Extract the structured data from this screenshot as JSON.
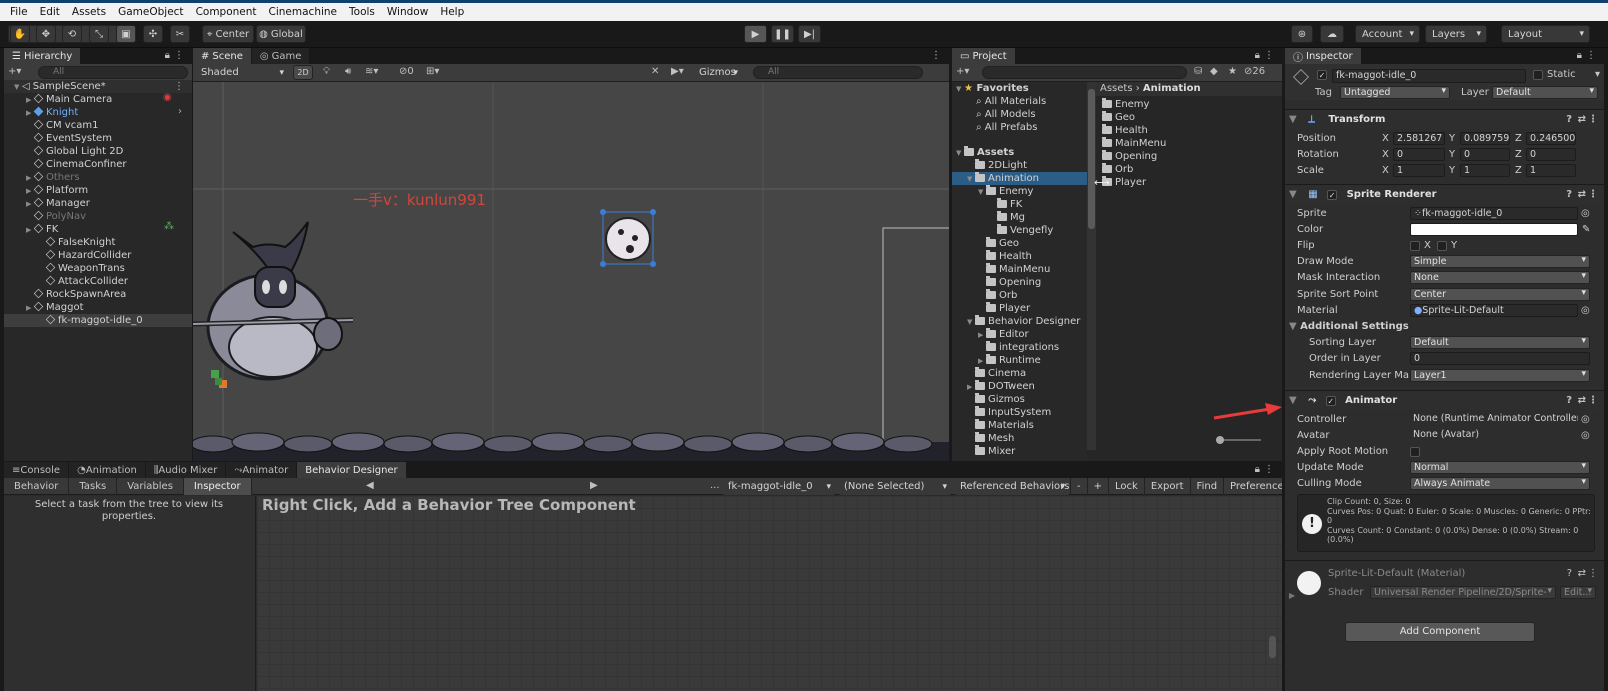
{
  "menu": [
    "File",
    "Edit",
    "Assets",
    "GameObject",
    "Component",
    "Cinemachine",
    "Tools",
    "Window",
    "Help"
  ],
  "toolbar": {
    "pivot": "Center",
    "space": "Global",
    "account": "Account",
    "layers": "Layers",
    "layout": "Layout"
  },
  "hierarchy": {
    "tab": "Hierarchy",
    "search_placeholder": "All",
    "scene": "SampleScene*",
    "items": [
      {
        "label": "Main Camera",
        "depth": 1,
        "arrow": true,
        "style": "normal"
      },
      {
        "label": "Knight",
        "depth": 1,
        "arrow": true,
        "style": "prefab"
      },
      {
        "label": "CM vcam1",
        "depth": 1,
        "arrow": false,
        "style": "normal"
      },
      {
        "label": "EventSystem",
        "depth": 1,
        "arrow": false,
        "style": "normal"
      },
      {
        "label": "Global Light 2D",
        "depth": 1,
        "arrow": false,
        "style": "normal"
      },
      {
        "label": "CinemaConfiner",
        "depth": 1,
        "arrow": false,
        "style": "normal"
      },
      {
        "label": "Others",
        "depth": 1,
        "arrow": true,
        "style": "dim"
      },
      {
        "label": "Platform",
        "depth": 1,
        "arrow": true,
        "style": "normal"
      },
      {
        "label": "Manager",
        "depth": 1,
        "arrow": true,
        "style": "normal"
      },
      {
        "label": "PolyNav",
        "depth": 1,
        "arrow": false,
        "style": "dim"
      },
      {
        "label": "FK",
        "depth": 1,
        "arrow": true,
        "style": "normal"
      },
      {
        "label": "FalseKnight",
        "depth": 2,
        "arrow": false,
        "style": "normal"
      },
      {
        "label": "HazardCollider",
        "depth": 2,
        "arrow": false,
        "style": "normal"
      },
      {
        "label": "WeaponTrans",
        "depth": 2,
        "arrow": false,
        "style": "normal"
      },
      {
        "label": "AttackCollider",
        "depth": 2,
        "arrow": false,
        "style": "normal"
      },
      {
        "label": "RockSpawnArea",
        "depth": 1,
        "arrow": false,
        "style": "normal"
      },
      {
        "label": "Maggot",
        "depth": 1,
        "arrow": true,
        "style": "normal"
      },
      {
        "label": "fk-maggot-idle_0",
        "depth": 2,
        "arrow": false,
        "style": "selected"
      }
    ]
  },
  "scene": {
    "tabs": [
      "Scene",
      "Game"
    ],
    "shading": "Shaded",
    "mode2d": "2D",
    "gizmos": "Gizmos",
    "gizmo_count": "0",
    "search_placeholder": "All",
    "watermark": "一手v：kunlun991"
  },
  "project": {
    "tab": "Project",
    "count": "26",
    "favorites_label": "Favorites",
    "favorites": [
      "All Materials",
      "All Models",
      "All Prefabs"
    ],
    "assets_label": "Assets",
    "tree": [
      {
        "label": "2DLight",
        "depth": 1,
        "sel": false
      },
      {
        "label": "Animation",
        "depth": 1,
        "sel": true
      },
      {
        "label": "Enemy",
        "depth": 2,
        "sel": false
      },
      {
        "label": "FK",
        "depth": 3,
        "sel": false
      },
      {
        "label": "Mg",
        "depth": 3,
        "sel": false
      },
      {
        "label": "Vengefly",
        "depth": 3,
        "sel": false
      },
      {
        "label": "Geo",
        "depth": 2,
        "sel": false
      },
      {
        "label": "Health",
        "depth": 2,
        "sel": false
      },
      {
        "label": "MainMenu",
        "depth": 2,
        "sel": false
      },
      {
        "label": "Opening",
        "depth": 2,
        "sel": false
      },
      {
        "label": "Orb",
        "depth": 2,
        "sel": false
      },
      {
        "label": "Player",
        "depth": 2,
        "sel": false
      },
      {
        "label": "Behavior Designer",
        "depth": 1,
        "sel": false
      },
      {
        "label": "Editor",
        "depth": 2,
        "sel": false
      },
      {
        "label": "integrations",
        "depth": 2,
        "sel": false
      },
      {
        "label": "Runtime",
        "depth": 2,
        "sel": false
      },
      {
        "label": "Cinema",
        "depth": 1,
        "sel": false
      },
      {
        "label": "DOTween",
        "depth": 1,
        "sel": false
      },
      {
        "label": "Gizmos",
        "depth": 1,
        "sel": false
      },
      {
        "label": "InputSystem",
        "depth": 1,
        "sel": false
      },
      {
        "label": "Materials",
        "depth": 1,
        "sel": false
      },
      {
        "label": "Mesh",
        "depth": 1,
        "sel": false
      },
      {
        "label": "Mixer",
        "depth": 1,
        "sel": false
      }
    ],
    "breadcrumb": [
      "Assets",
      "Animation"
    ],
    "contents": [
      "Enemy",
      "Geo",
      "Health",
      "MainMenu",
      "Opening",
      "Orb",
      "Player"
    ]
  },
  "bottom": {
    "tabs": [
      "Console",
      "Animation",
      "Audio Mixer",
      "Animator",
      "Behavior Designer"
    ],
    "subtabs": [
      "Behavior",
      "Tasks",
      "Variables",
      "Inspector"
    ],
    "hint": "Select a task from the tree to view its properties.",
    "object": "fk-maggot-idle_0",
    "selection": "(None Selected)",
    "referenced": "Referenced Behaviors",
    "buttons": [
      "-",
      "+",
      "Lock",
      "Export",
      "Find",
      "Preferences"
    ],
    "canvas_message": "Right Click, Add a Behavior Tree Component"
  },
  "inspector": {
    "tab": "Inspector",
    "object_name": "fk-maggot-idle_0",
    "static": "Static",
    "tag_label": "Tag",
    "tag": "Untagged",
    "layer_label": "Layer",
    "layer": "Default",
    "transform": {
      "title": "Transform",
      "position_label": "Position",
      "rotation_label": "Rotation",
      "scale_label": "Scale",
      "position": [
        "2.581267",
        "0.089759",
        "0.246500"
      ],
      "rotation": [
        "0",
        "0",
        "0"
      ],
      "scale": [
        "1",
        "1",
        "1"
      ]
    },
    "sprite_renderer": {
      "title": "Sprite Renderer",
      "sprite_label": "Sprite",
      "sprite": "fk-maggot-idle_0",
      "color_label": "Color",
      "color": "#ffffff",
      "flip_label": "Flip",
      "flip_x": "X",
      "flip_y": "Y",
      "draw_mode_label": "Draw Mode",
      "draw_mode": "Simple",
      "mask_label": "Mask Interaction",
      "mask": "None",
      "sort_point_label": "Sprite Sort Point",
      "sort_point": "Center",
      "material_label": "Material",
      "material": "Sprite-Lit-Default",
      "additional": "Additional Settings",
      "sorting_layer_label": "Sorting Layer",
      "sorting_layer": "Default",
      "order_label": "Order in Layer",
      "order": "0",
      "rendering_layer_label": "Rendering Layer Mas",
      "rendering_layer": "Layer1"
    },
    "animator": {
      "title": "Animator",
      "controller_label": "Controller",
      "controller": "None (Runtime Animator Controller)",
      "avatar_label": "Avatar",
      "avatar": "None (Avatar)",
      "root_motion_label": "Apply Root Motion",
      "update_label": "Update Mode",
      "update": "Normal",
      "culling_label": "Culling Mode",
      "culling": "Always Animate",
      "info": [
        "Clip Count: 0, Size: 0",
        "Curves Pos: 0 Quat: 0 Euler: 0 Scale: 0 Muscles: 0 Generic: 0 PPtr: 0",
        "Curves Count: 0 Constant: 0 (0.0%) Dense: 0 (0.0%) Stream: 0 (0.0%)"
      ]
    },
    "material": {
      "title": "Sprite-Lit-Default (Material)",
      "shader_label": "Shader",
      "shader": "Universal Render Pipeline/2D/Sprite-",
      "edit": "Edit..."
    },
    "add_component": "Add Component"
  },
  "colors": {
    "accent": "#2c5d87",
    "annotation_arrow": "#e83b3b",
    "watermark": "#d0463b"
  }
}
